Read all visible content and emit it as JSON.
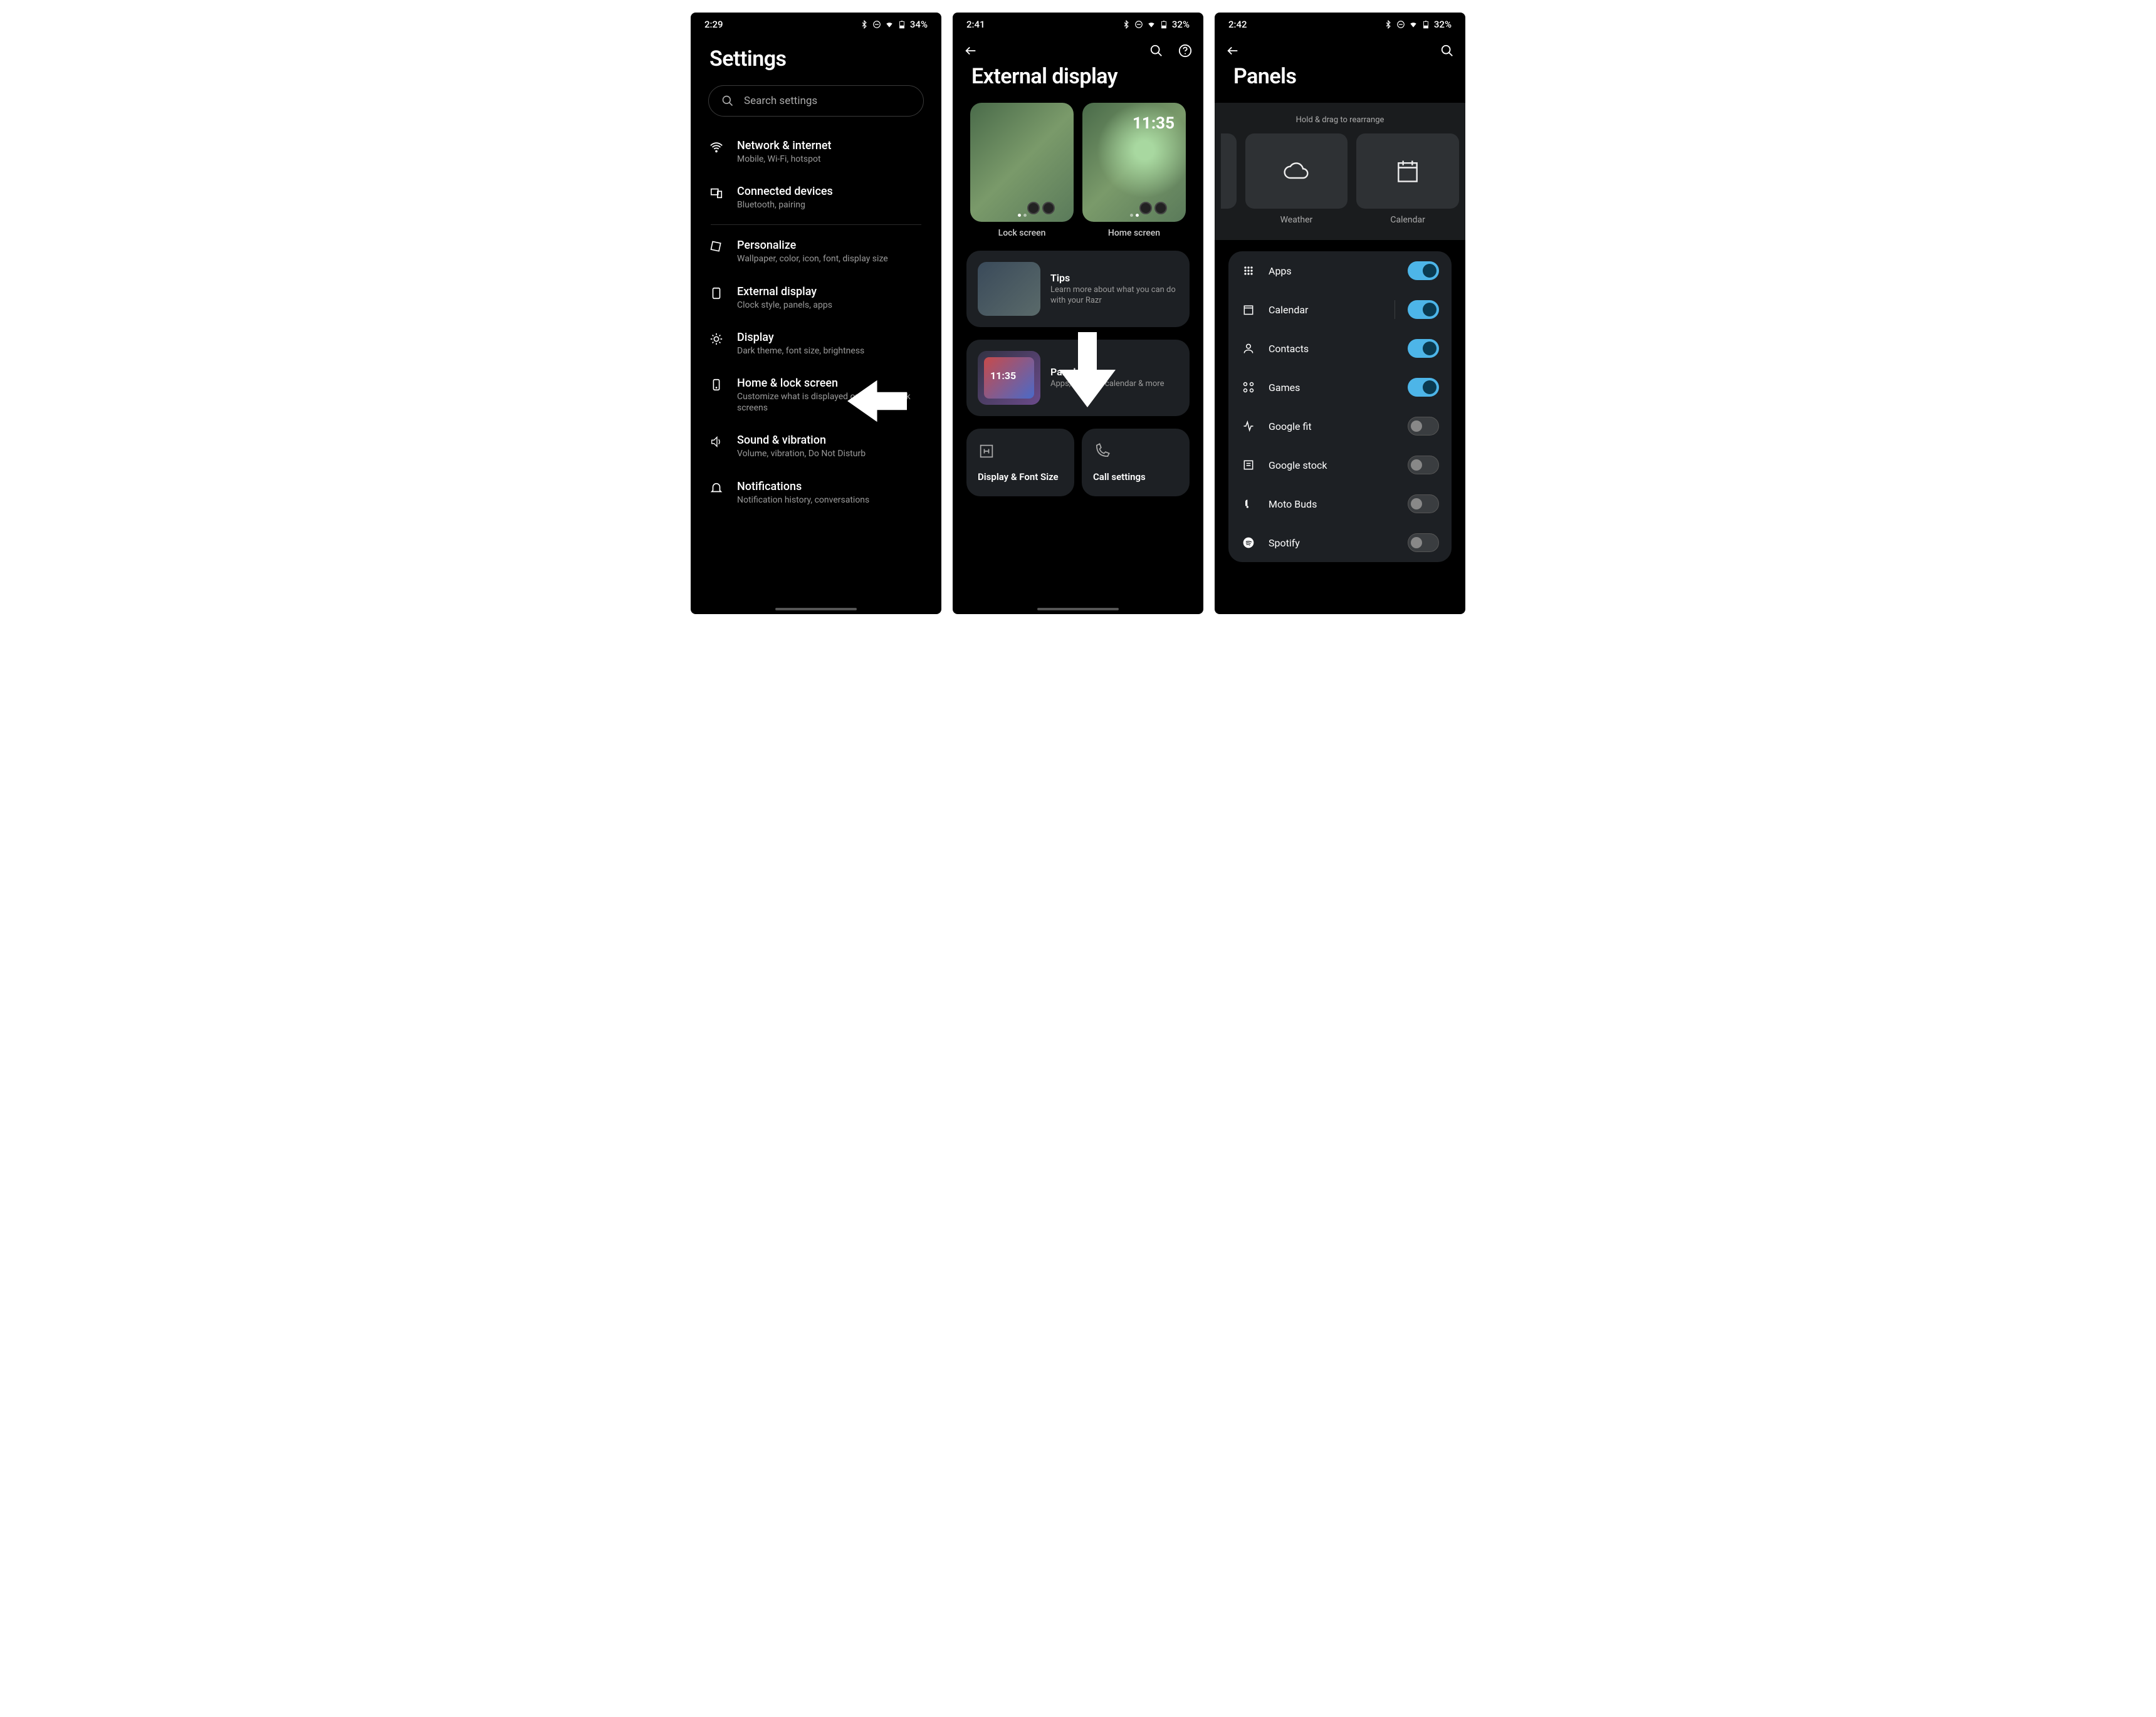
{
  "screen1": {
    "time": "2:29",
    "battery": "34%",
    "title": "Settings",
    "search_placeholder": "Search settings",
    "items": [
      {
        "title": "Network & internet",
        "sub": "Mobile, Wi-Fi, hotspot"
      },
      {
        "title": "Connected devices",
        "sub": "Bluetooth, pairing"
      },
      {
        "title": "Personalize",
        "sub": "Wallpaper, color, icon, font, display size"
      },
      {
        "title": "External display",
        "sub": "Clock style, panels, apps"
      },
      {
        "title": "Display",
        "sub": "Dark theme, font size, brightness"
      },
      {
        "title": "Home & lock screen",
        "sub": "Customize what is displayed on home & lock screens"
      },
      {
        "title": "Sound & vibration",
        "sub": "Volume, vibration, Do Not Disturb"
      },
      {
        "title": "Notifications",
        "sub": "Notification history, conversations"
      }
    ]
  },
  "screen2": {
    "time": "2:41",
    "battery": "32%",
    "title": "External display",
    "previews": {
      "lock": "Lock screen",
      "home": "Home screen",
      "home_time": "11:35"
    },
    "cards": {
      "tips": {
        "title": "Tips",
        "sub": "Learn more about what you can do with your Razr"
      },
      "panels": {
        "title": "Panels",
        "sub": "Apps, weather, calendar & more",
        "thumb_time": "11:35"
      },
      "display_font": "Display & Font Size",
      "call": "Call settings"
    }
  },
  "screen3": {
    "time": "2:42",
    "battery": "32%",
    "title": "Panels",
    "hint": "Hold & drag to rearrange",
    "tiles": [
      {
        "label": "Weather"
      },
      {
        "label": "Calendar"
      }
    ],
    "toggles": [
      {
        "label": "Apps",
        "on": true
      },
      {
        "label": "Calendar",
        "on": true,
        "divider": true
      },
      {
        "label": "Contacts",
        "on": true
      },
      {
        "label": "Games",
        "on": true
      },
      {
        "label": "Google fit",
        "on": false
      },
      {
        "label": "Google stock",
        "on": false
      },
      {
        "label": "Moto Buds",
        "on": false
      },
      {
        "label": "Spotify",
        "on": false
      }
    ]
  }
}
